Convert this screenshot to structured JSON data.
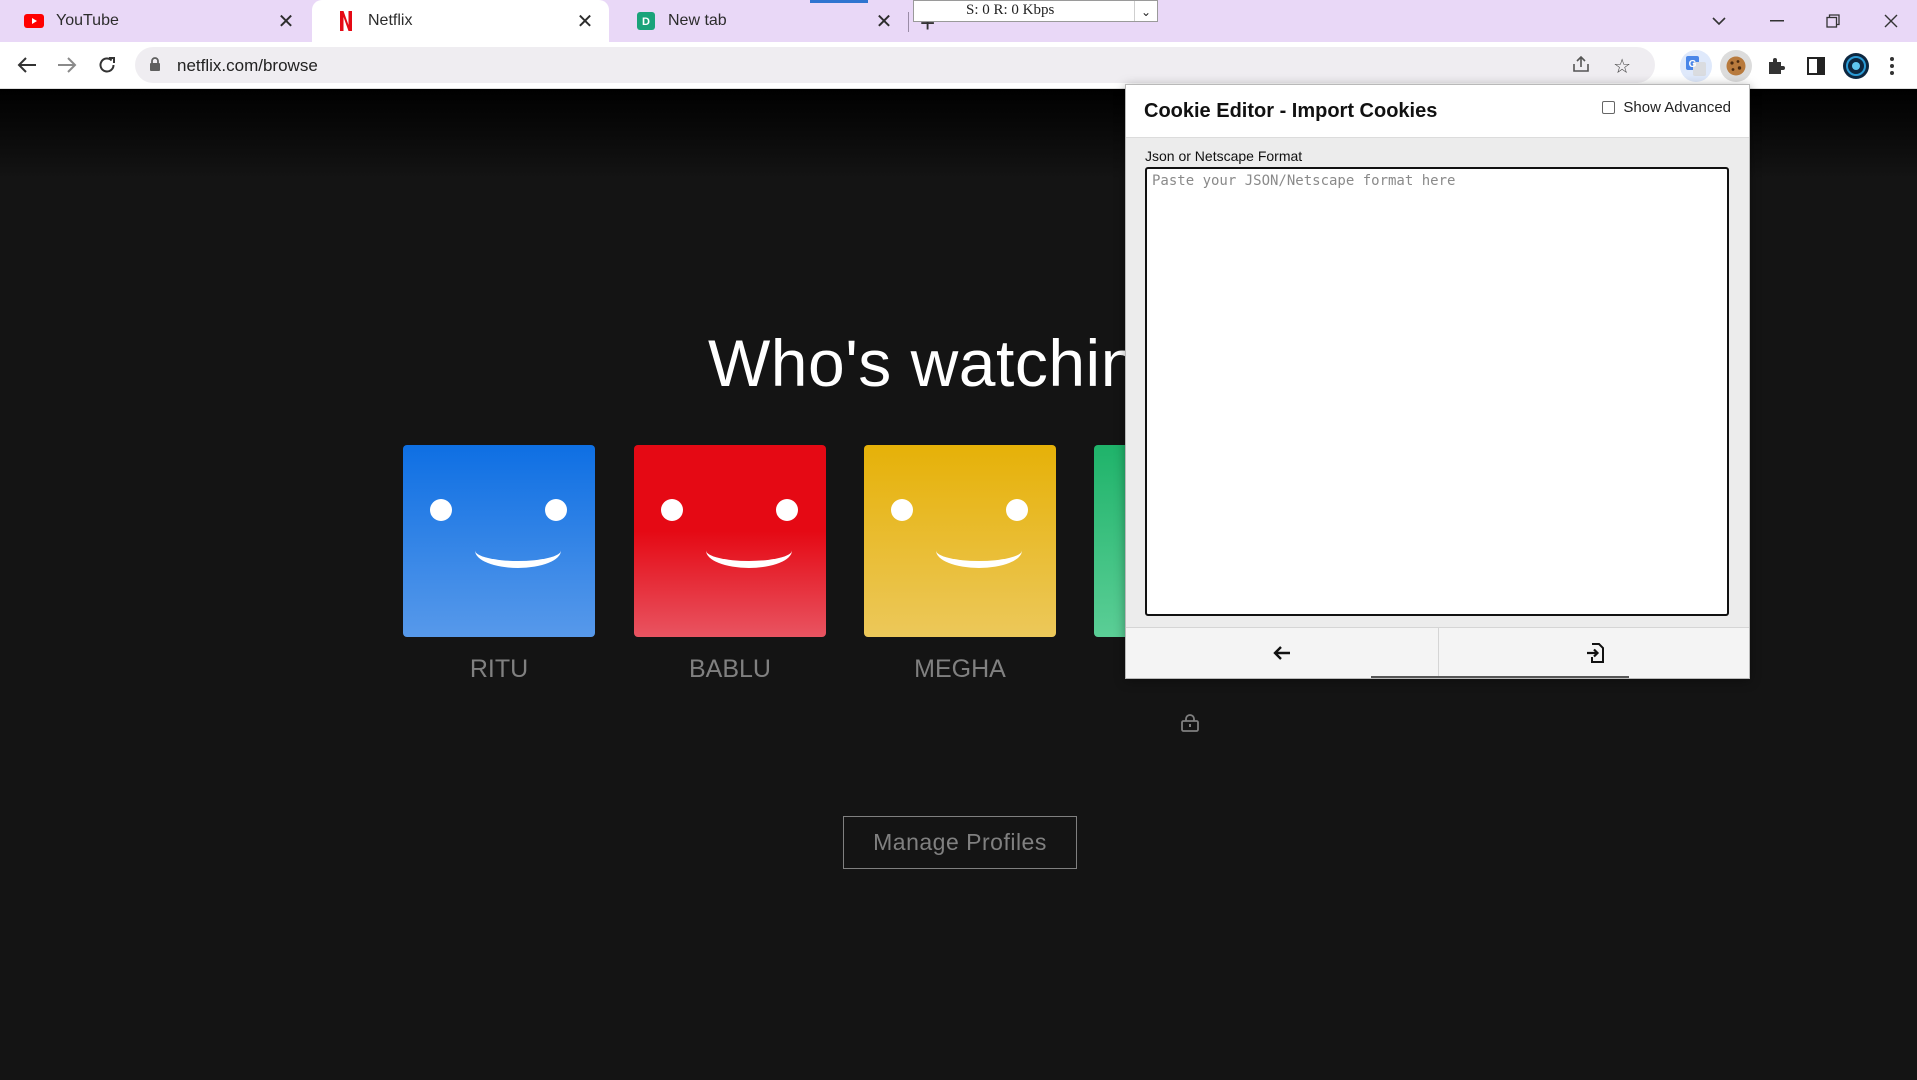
{
  "browser": {
    "tabs": [
      {
        "title": "YouTube",
        "active": false
      },
      {
        "title": "Netflix",
        "active": true
      },
      {
        "title": "New tab",
        "active": false
      }
    ],
    "speed_widget": "S: 0 R: 0 Kbps",
    "url": "netflix.com/browse"
  },
  "page": {
    "heading": "Who's watchin",
    "profiles": [
      {
        "name": "RITU",
        "color_top": "#0e6fe3",
        "color_bottom": "#5799ea"
      },
      {
        "name": "BABLU",
        "color_top": "#e50914",
        "color_bottom": "#e85461"
      },
      {
        "name": "MEGHA",
        "color_top": "#e6b108",
        "color_bottom": "#ecc85a"
      }
    ],
    "manage_profiles": "Manage Profiles"
  },
  "cookie_editor": {
    "title": "Cookie Editor - Import Cookies",
    "show_advanced_label": "Show Advanced",
    "show_advanced_checked": false,
    "field_label": "Json or Netscape Format",
    "placeholder": "Paste your JSON/Netscape format here",
    "value": ""
  },
  "colors": {
    "tab_strip": "#e9d8f7",
    "netflix_bg": "#141414",
    "netflix_red": "#e50914"
  }
}
